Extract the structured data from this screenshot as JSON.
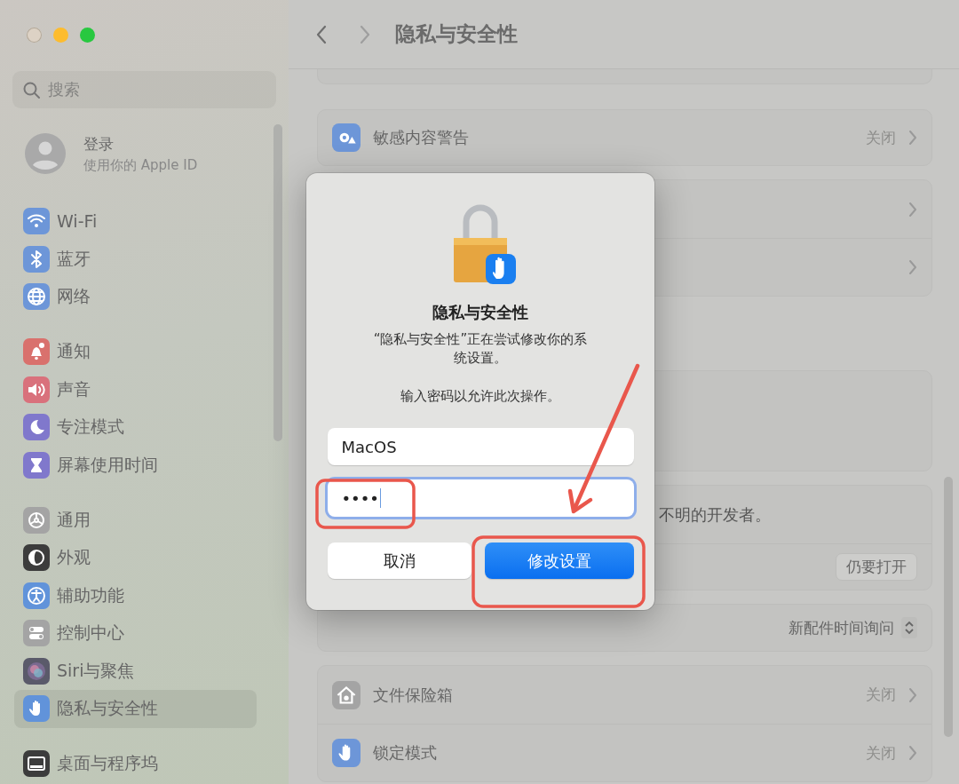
{
  "sidebar": {
    "search": {
      "placeholder": "搜索"
    },
    "account": {
      "title": "登录",
      "subtitle": "使用你的 Apple ID"
    },
    "groups": [
      {
        "items": [
          {
            "label": "Wi-Fi",
            "color": "#6d96d8",
            "selected": false
          },
          {
            "label": "蓝牙",
            "color": "#6d96d8",
            "selected": false
          },
          {
            "label": "网络",
            "color": "#6d96d8",
            "selected": false
          }
        ]
      },
      {
        "items": [
          {
            "label": "通知",
            "color": "#d9716d",
            "selected": false
          },
          {
            "label": "声音",
            "color": "#d9717c",
            "selected": false
          },
          {
            "label": "专注模式",
            "color": "#8078cc",
            "selected": false
          },
          {
            "label": "屏幕使用时间",
            "color": "#8078cc",
            "selected": false
          }
        ]
      },
      {
        "items": [
          {
            "label": "通用",
            "color": "#a4a4a4",
            "selected": false
          },
          {
            "label": "外观",
            "color": "#3c3c3c",
            "selected": false
          },
          {
            "label": "辅助功能",
            "color": "#6193da",
            "selected": false
          },
          {
            "label": "控制中心",
            "color": "#a4a4a4",
            "selected": false
          },
          {
            "label": "Siri与聚焦",
            "color": "#5a5a6a",
            "selected": false
          },
          {
            "label": "隐私与安全性",
            "color": "#6193da",
            "selected": true
          }
        ]
      },
      {
        "items": [
          {
            "label": "桌面与程序坞",
            "color": "#3c3c3c",
            "selected": false
          }
        ]
      }
    ]
  },
  "header": {
    "title": "隐私与安全性"
  },
  "cards": [
    {
      "kind": "sliver"
    },
    {
      "kind": "list",
      "rows": [
        {
          "kind": "link",
          "label": "敏感内容警告",
          "value": "关闭",
          "color": "#6d96d8"
        }
      ]
    },
    {
      "kind": "list",
      "rows": [
        {
          "kind": "chevron"
        },
        {
          "kind": "chevron"
        }
      ]
    },
    {
      "kind": "hidden"
    },
    {
      "kind": "list",
      "rows": [
        {
          "kind": "text",
          "text": "不明的开发者。"
        },
        {
          "kind": "button",
          "label": "仍要打开"
        }
      ]
    },
    {
      "kind": "list",
      "rows": [
        {
          "kind": "popup",
          "value": "新配件时间询问"
        }
      ]
    },
    {
      "kind": "list",
      "rows": [
        {
          "kind": "link",
          "label": "文件保险箱",
          "value": "关闭",
          "color": "#a4a4a4"
        },
        {
          "kind": "link",
          "label": "锁定模式",
          "value": "关闭",
          "color": "#6d96d8"
        }
      ]
    }
  ],
  "dialog": {
    "title": "隐私与安全性",
    "message": "“隐私与安全性”正在尝试修改你的系统设置。",
    "prompt": "输入密码以允许此次操作。",
    "username": {
      "value": "MacOS"
    },
    "password": {
      "value": "••••",
      "focused": true,
      "highlighted": true
    },
    "buttons": [
      {
        "label": "取消",
        "kind": "cancel",
        "highlighted": false
      },
      {
        "label": "修改设置",
        "kind": "default",
        "highlighted": true
      }
    ],
    "arrow": true
  }
}
